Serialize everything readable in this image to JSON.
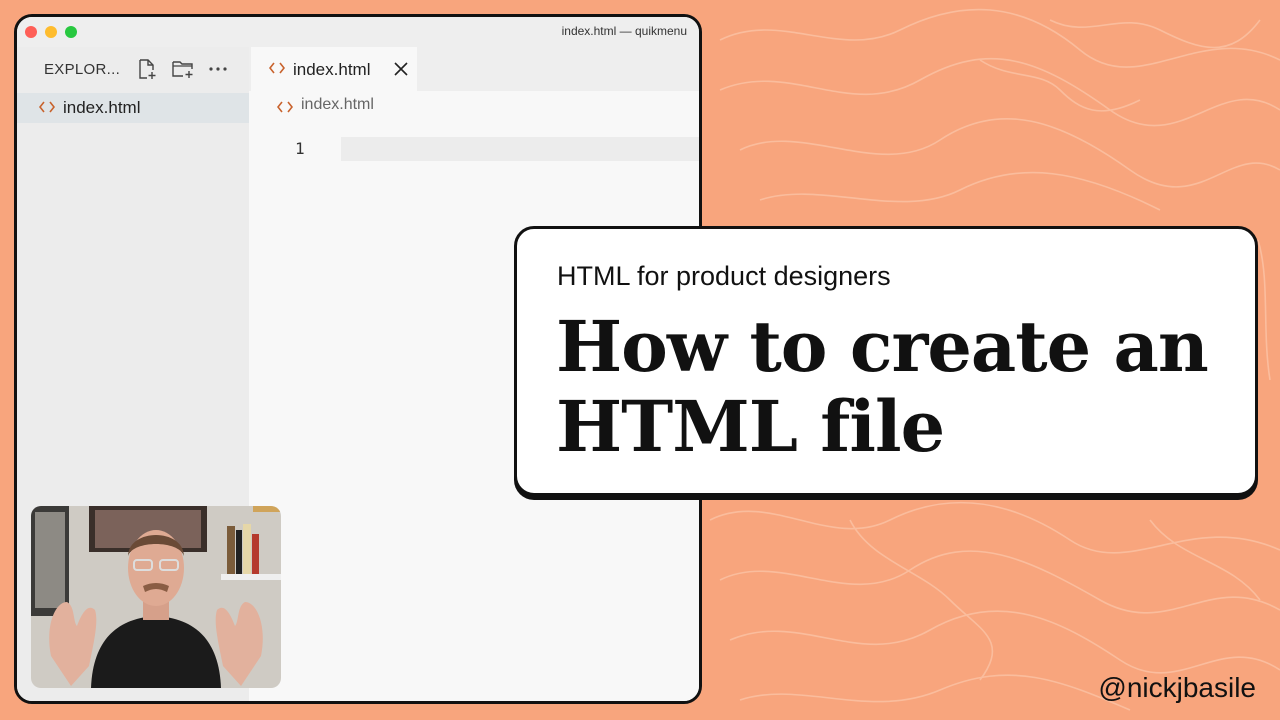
{
  "window": {
    "title": "index.html — quikmenu"
  },
  "explorer": {
    "title": "EXPLOR...",
    "new_file_icon": "new-file-icon",
    "new_folder_icon": "new-folder-icon",
    "more_icon": "ellipsis-icon",
    "files": [
      {
        "name": "index.html",
        "icon": "html-code-icon",
        "selected": true
      }
    ]
  },
  "editor": {
    "tab_label": "index.html",
    "breadcrumb": "index.html",
    "line_numbers": [
      "1"
    ]
  },
  "card": {
    "subtitle": "HTML for product designers",
    "title": "How to create an HTML file"
  },
  "handle": "@nickjbasile",
  "colors": {
    "background": "#f8a57d",
    "accent_icon": "#c8622c",
    "card_border": "#111111"
  }
}
